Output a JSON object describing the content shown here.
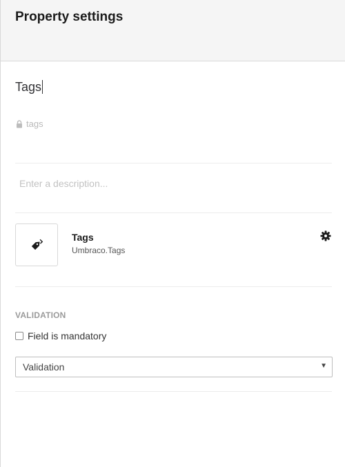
{
  "header": {
    "title": "Property settings"
  },
  "property": {
    "name": "Tags",
    "alias": "tags",
    "description_placeholder": "Enter a description..."
  },
  "editor": {
    "name": "Tags",
    "alias": "Umbraco.Tags",
    "icon": "tag-icon",
    "settings_icon": "gear-icon"
  },
  "validation": {
    "heading": "VALIDATION",
    "mandatory_label": "Field is mandatory",
    "mandatory_checked": false,
    "select_value": "Validation"
  },
  "colors": {
    "header_bg": "#f5f5f5",
    "muted_text": "#9a9a9a",
    "border": "#d8d8d8"
  }
}
